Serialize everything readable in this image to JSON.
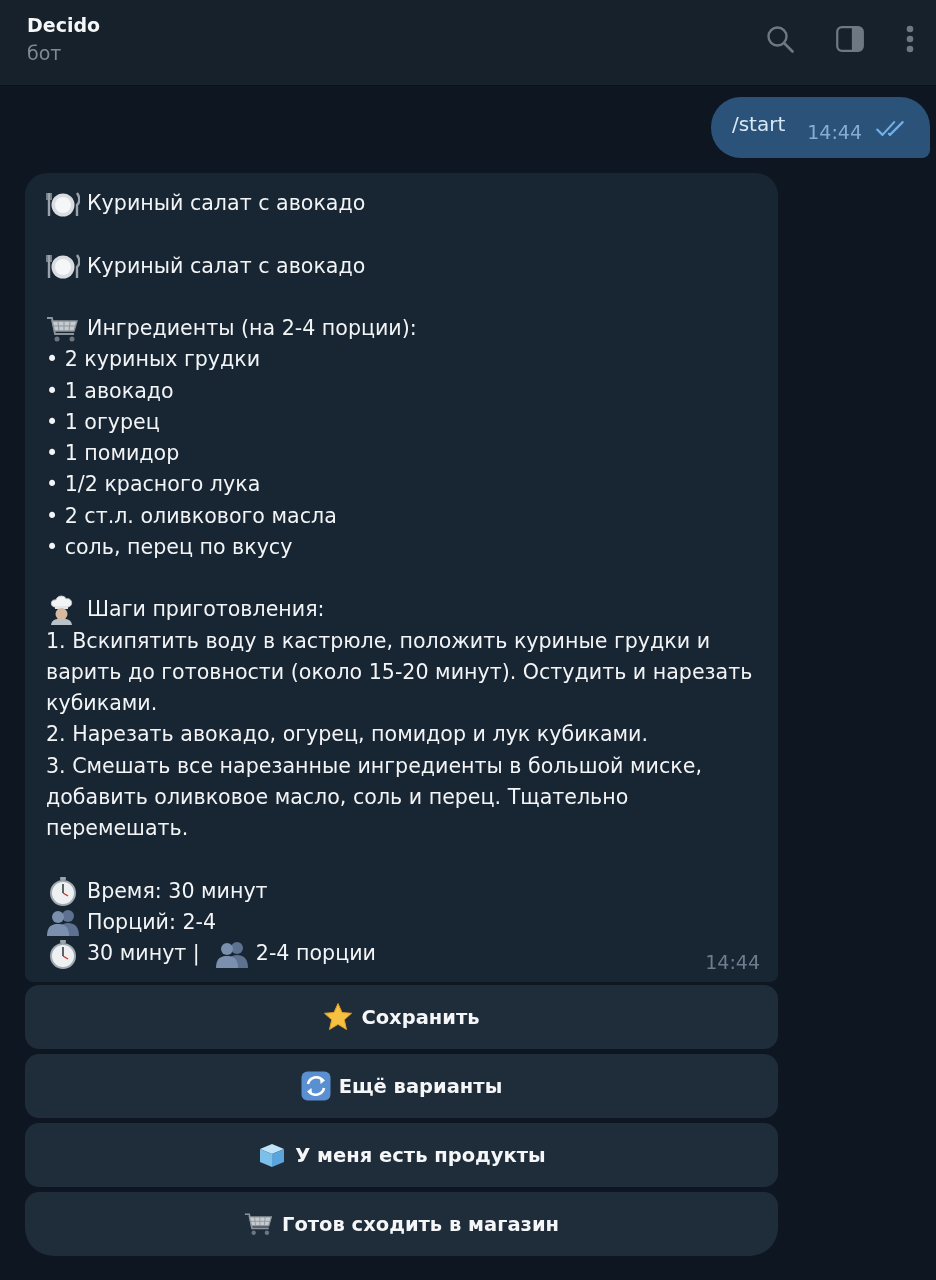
{
  "header": {
    "title": "Decido",
    "subtitle": "бот"
  },
  "outgoing": {
    "text": "/start",
    "time": "14:44",
    "read": true
  },
  "incoming": {
    "titles": [
      "Куриный салат с авокадо",
      "Куриный салат с авокадо"
    ],
    "ingredients": {
      "heading": "Ингредиенты (на 2-4 порции):",
      "items": [
        "• 2 куриных грудки",
        "• 1 авокадо",
        "• 1 огурец",
        "• 1 помидор",
        "• 1/2 красного лука",
        "• 2 ст.л. оливкового масла",
        "• соль, перец по вкусу"
      ]
    },
    "steps": {
      "heading": "Шаги приготовления:",
      "items": [
        "1. Вскипятить воду в кастрюле, положить куриные грудки и варить до готовности (около 15-20 минут). Остудить и нарезать кубиками.",
        "2. Нарезать авокадо, огурец, помидор и лук кубиками.",
        "3. Смешать все нарезанные ингредиенты в большой миске, добавить оливковое масло, соль и перец. Тщательно перемешать."
      ]
    },
    "time": "Время: 30 минут",
    "servings": "Порций: 2-4",
    "summary": {
      "time": "30 минут |",
      "servings": "2-4 порции"
    },
    "timestamp": "14:44"
  },
  "buttons": [
    {
      "label": "Сохранить",
      "kind": "save"
    },
    {
      "label": "Ещё варианты",
      "kind": "refresh"
    },
    {
      "label": "У меня есть продукты",
      "kind": "pantry"
    },
    {
      "label": "Готов сходить в магазин",
      "kind": "shop"
    }
  ]
}
